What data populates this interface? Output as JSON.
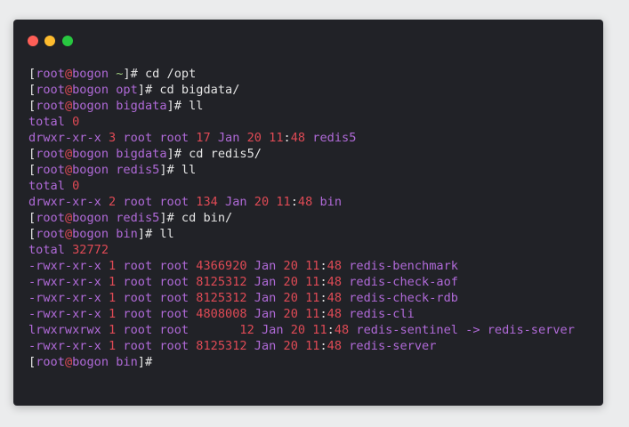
{
  "window": {
    "controls": [
      {
        "name": "close",
        "color": "#ff5f57"
      },
      {
        "name": "minimize",
        "color": "#febc2e"
      },
      {
        "name": "zoom",
        "color": "#28c840"
      }
    ]
  },
  "prompt": {
    "user": "root",
    "host": "bogon"
  },
  "lines": [
    {
      "kind": "prompt",
      "cwd": "~",
      "command": "cd /opt"
    },
    {
      "kind": "prompt",
      "cwd": "opt",
      "command": "cd bigdata/"
    },
    {
      "kind": "prompt",
      "cwd": "bigdata",
      "command": "ll"
    },
    {
      "kind": "total",
      "label": "total",
      "value": "0"
    },
    {
      "kind": "entry",
      "perms": "drwxr-xr-x",
      "links": "3",
      "owner": "root",
      "group": "root",
      "size": "17",
      "month": "Jan",
      "day": "20",
      "hour": "11",
      "minute": "48",
      "name": "redis5",
      "pad": ""
    },
    {
      "kind": "prompt",
      "cwd": "bigdata",
      "command": "cd redis5/"
    },
    {
      "kind": "prompt",
      "cwd": "redis5",
      "command": "ll"
    },
    {
      "kind": "total",
      "label": "total",
      "value": "0"
    },
    {
      "kind": "entry",
      "perms": "drwxr-xr-x",
      "links": "2",
      "owner": "root",
      "group": "root",
      "size": "134",
      "month": "Jan",
      "day": "20",
      "hour": "11",
      "minute": "48",
      "name": "bin",
      "pad": ""
    },
    {
      "kind": "prompt",
      "cwd": "redis5",
      "command": "cd bin/"
    },
    {
      "kind": "prompt",
      "cwd": "bin",
      "command": "ll"
    },
    {
      "kind": "total",
      "label": "total",
      "value": "32772"
    },
    {
      "kind": "entry",
      "perms": "-rwxr-xr-x",
      "links": "1",
      "owner": "root",
      "group": "root",
      "size": "4366920",
      "month": "Jan",
      "day": "20",
      "hour": "11",
      "minute": "48",
      "name": "redis-benchmark",
      "pad": ""
    },
    {
      "kind": "entry",
      "perms": "-rwxr-xr-x",
      "links": "1",
      "owner": "root",
      "group": "root",
      "size": "8125312",
      "month": "Jan",
      "day": "20",
      "hour": "11",
      "minute": "48",
      "name": "redis-check-aof",
      "pad": ""
    },
    {
      "kind": "entry",
      "perms": "-rwxr-xr-x",
      "links": "1",
      "owner": "root",
      "group": "root",
      "size": "8125312",
      "month": "Jan",
      "day": "20",
      "hour": "11",
      "minute": "48",
      "name": "redis-check-rdb",
      "pad": ""
    },
    {
      "kind": "entry",
      "perms": "-rwxr-xr-x",
      "links": "1",
      "owner": "root",
      "group": "root",
      "size": "4808008",
      "month": "Jan",
      "day": "20",
      "hour": "11",
      "minute": "48",
      "name": "redis-cli",
      "pad": ""
    },
    {
      "kind": "entry",
      "perms": "lrwxrwxrwx",
      "links": "1",
      "owner": "root",
      "group": "root",
      "size": "12",
      "month": "Jan",
      "day": "20",
      "hour": "11",
      "minute": "48",
      "name": "redis-sentinel -> redis-server",
      "pad": "      "
    },
    {
      "kind": "entry",
      "perms": "-rwxr-xr-x",
      "links": "1",
      "owner": "root",
      "group": "root",
      "size": "8125312",
      "month": "Jan",
      "day": "20",
      "hour": "11",
      "minute": "48",
      "name": "redis-server",
      "pad": ""
    },
    {
      "kind": "prompt",
      "cwd": "bin",
      "command": ""
    }
  ]
}
